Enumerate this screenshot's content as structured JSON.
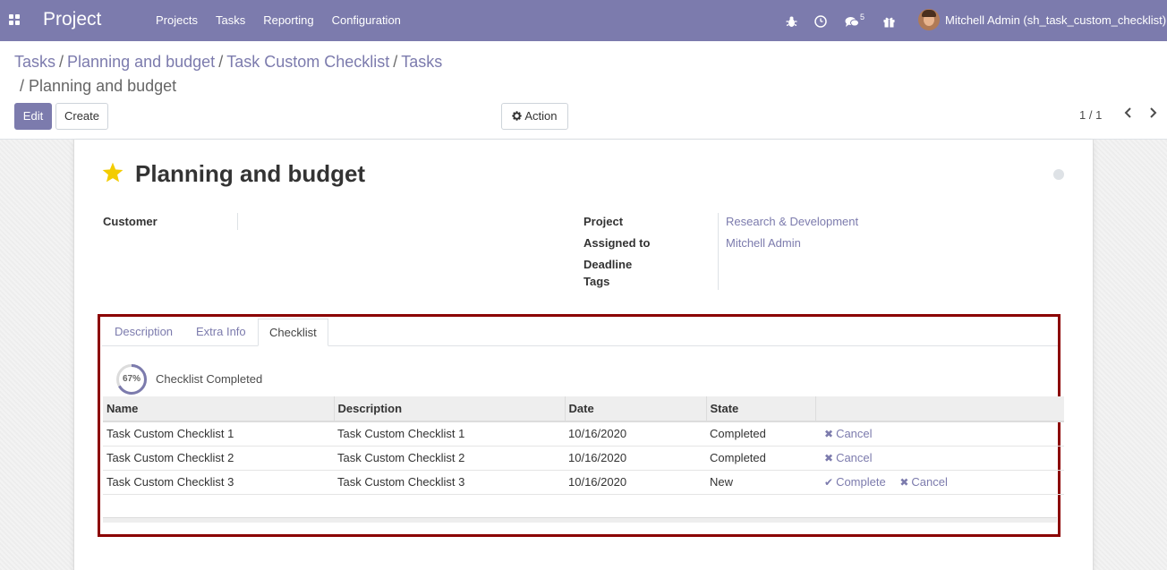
{
  "navbar": {
    "brand": "Project",
    "menu": [
      "Projects",
      "Tasks",
      "Reporting",
      "Configuration"
    ],
    "chat_badge": "5",
    "user": "Mitchell Admin (sh_task_custom_checklist)"
  },
  "breadcrumb": {
    "items": [
      "Tasks",
      "Planning and budget",
      "Task Custom Checklist",
      "Tasks"
    ],
    "separator": "/",
    "current": "Planning and budget"
  },
  "buttons": {
    "edit": "Edit",
    "create": "Create",
    "action": "Action"
  },
  "pager": {
    "value": "1 / 1"
  },
  "task": {
    "title": "Planning and budget",
    "labels": {
      "customer": "Customer",
      "project": "Project",
      "assigned_to": "Assigned to",
      "deadline": "Deadline",
      "tags": "Tags"
    },
    "project": "Research & Development",
    "assigned_to": "Mitchell Admin"
  },
  "tabs": [
    "Description",
    "Extra Info",
    "Checklist"
  ],
  "active_tab": "Checklist",
  "checklist": {
    "progress_percent": 67,
    "progress_text": "67%",
    "label": "Checklist Completed",
    "columns": [
      "Name",
      "Description",
      "Date",
      "State",
      ""
    ],
    "rows": [
      {
        "name": "Task Custom Checklist 1",
        "description": "Task Custom Checklist 1",
        "date": "10/16/2020",
        "state": "Completed",
        "actions": [
          "Cancel"
        ]
      },
      {
        "name": "Task Custom Checklist 2",
        "description": "Task Custom Checklist 2",
        "date": "10/16/2020",
        "state": "Completed",
        "actions": [
          "Cancel"
        ]
      },
      {
        "name": "Task Custom Checklist 3",
        "description": "Task Custom Checklist 3",
        "date": "10/16/2020",
        "state": "New",
        "actions": [
          "Complete",
          "Cancel"
        ]
      }
    ]
  },
  "colors": {
    "brand": "#7c7bad",
    "highlight_border": "#8b0000",
    "star": "#f3cc00"
  }
}
